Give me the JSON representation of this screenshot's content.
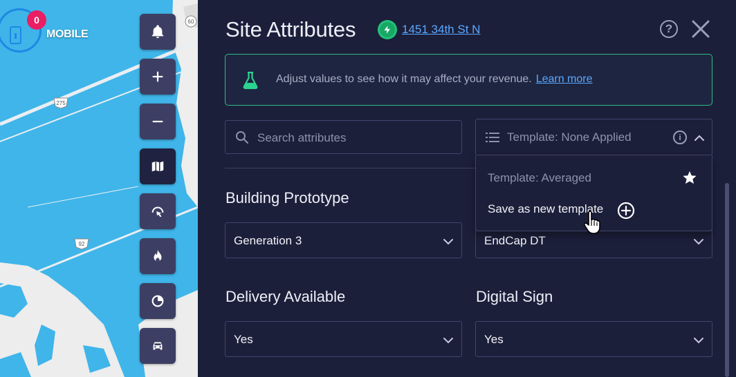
{
  "map": {
    "mobile_count": "0",
    "mobile_label": "MOBILE",
    "road_shields": [
      "275",
      "92",
      "60"
    ],
    "map_tool_icons": [
      "bell-icon",
      "zoom-in-icon",
      "zoom-out-icon",
      "map-icon",
      "drive-time-icon",
      "heatmap-icon",
      "pie-chart-icon",
      "car-icon"
    ]
  },
  "panel": {
    "title": "Site Attributes",
    "address": "1451 34th St N",
    "info": {
      "text": "Adjust values to see how it may affect your revenue.",
      "link": "Learn more"
    },
    "search_placeholder": "Search attributes",
    "template": {
      "label": "Template: None Applied",
      "options": [
        "Template: Averaged",
        "Save as new template"
      ]
    },
    "fields": {
      "building_prototype": {
        "label": "Building Prototype",
        "value": "Generation 3"
      },
      "building_type": {
        "value": "EndCap DT"
      },
      "delivery": {
        "label": "Delivery Available",
        "value": "Yes"
      },
      "digital_sign": {
        "label": "Digital Sign",
        "value": "Yes"
      }
    }
  },
  "colors": {
    "panel_bg": "#1c1f3a",
    "accent_green": "#2bbf86",
    "link_blue": "#5aa9ff",
    "map_water": "#3fb5e9",
    "badge_pink": "#e91e63"
  }
}
